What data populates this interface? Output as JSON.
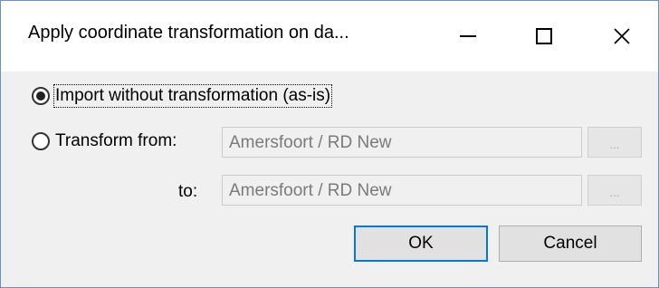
{
  "window": {
    "title": "Apply coordinate transformation on da...",
    "controls": {
      "minimize": "minimize-icon",
      "maximize": "maximize-icon",
      "close": "close-icon"
    }
  },
  "options": {
    "import_as_is": {
      "label": "Import without transformation (as-is)",
      "selected": true
    },
    "transform": {
      "label": "Transform from:",
      "selected": false
    }
  },
  "from_field": {
    "value": "Amersfoort / RD New",
    "browse_label": "..."
  },
  "to_field": {
    "label": "to:",
    "value": "Amersfoort / RD New",
    "browse_label": "..."
  },
  "buttons": {
    "ok": "OK",
    "cancel": "Cancel"
  },
  "colors": {
    "accent": "#0078d7",
    "window_border": "#6f8fb6",
    "body_bg": "#f0f0f0"
  }
}
